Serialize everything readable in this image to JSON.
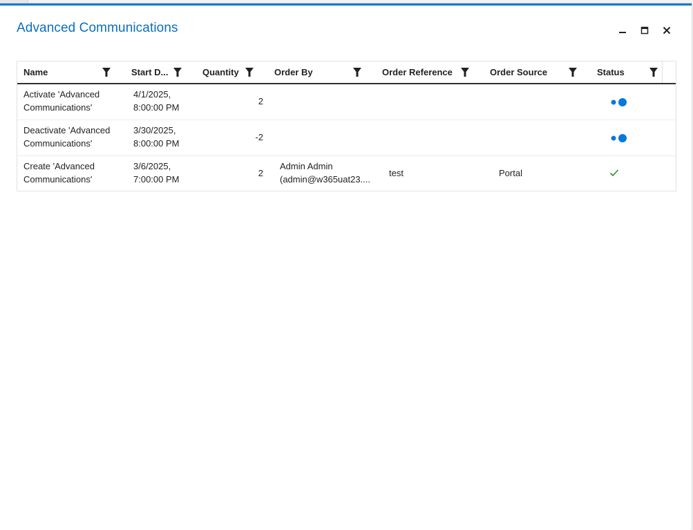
{
  "dialog": {
    "title": "Advanced Communications"
  },
  "window_controls": {
    "minimize_icon": "minimize-icon",
    "maximize_icon": "maximize-icon",
    "close_icon": "close-icon"
  },
  "grid": {
    "columns": [
      {
        "label": "Name"
      },
      {
        "label": "Start D..."
      },
      {
        "label": "Quantity"
      },
      {
        "label": "Order By"
      },
      {
        "label": "Order Reference"
      },
      {
        "label": "Order Source"
      },
      {
        "label": "Status"
      }
    ],
    "rows": [
      {
        "name_line1": "Activate 'Advanced",
        "name_line2": "Communications'",
        "date_line1": "4/1/2025,",
        "date_line2": "8:00:00 PM",
        "quantity": "2",
        "order_by_line1": "",
        "order_by_line2": "",
        "order_reference": "",
        "order_source": "",
        "status": "pending"
      },
      {
        "name_line1": "Deactivate 'Advanced",
        "name_line2": "Communications'",
        "date_line1": "3/30/2025,",
        "date_line2": "8:00:00 PM",
        "quantity": "-2",
        "order_by_line1": "",
        "order_by_line2": "",
        "order_reference": "",
        "order_source": "",
        "status": "pending"
      },
      {
        "name_line1": "Create 'Advanced",
        "name_line2": "Communications'",
        "date_line1": "3/6/2025,",
        "date_line2": "7:00:00 PM",
        "quantity": "2",
        "order_by_line1": "Admin Admin",
        "order_by_line2": "(admin@w365uat23....",
        "order_reference": "test",
        "order_source": "Portal",
        "status": "completed"
      }
    ]
  },
  "colors": {
    "accent": "#0078d4",
    "title": "#0a6ebd",
    "status_pending": "#0a78d7",
    "status_completed": "#2e8b2e"
  }
}
